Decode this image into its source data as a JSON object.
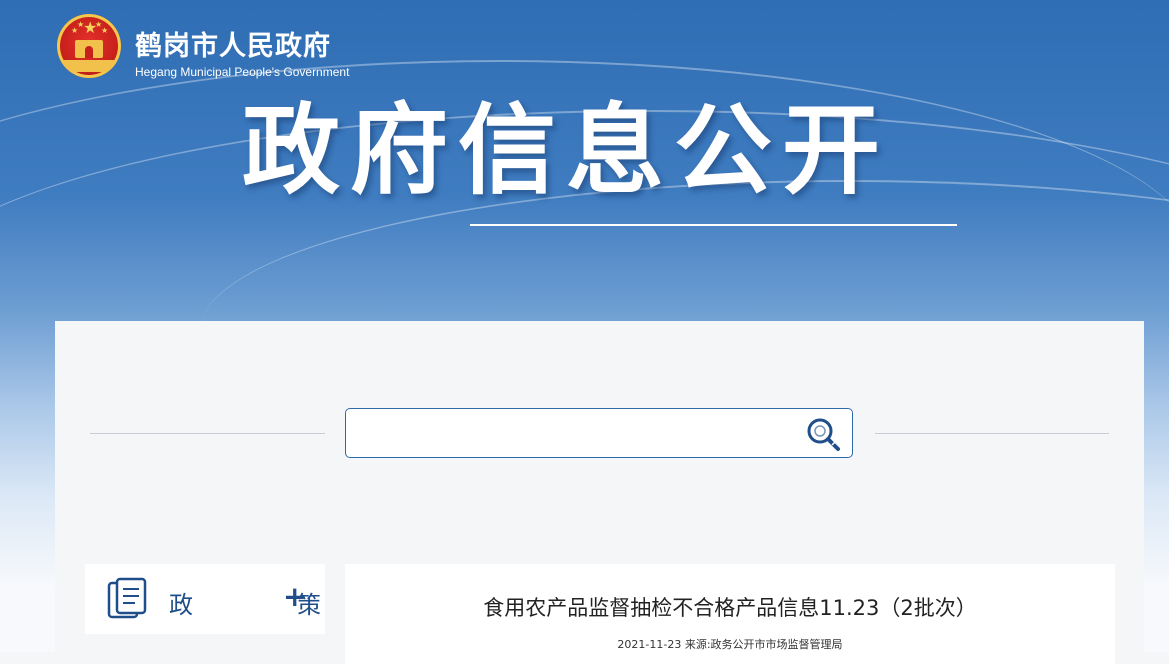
{
  "header": {
    "site_title": "鹤岗市人民政府",
    "site_subtitle": "Hegang Municipal People's Government",
    "hero_title": "政府信息公开"
  },
  "search": {
    "placeholder": "",
    "value": ""
  },
  "sidebar": {
    "section_label": "政　策",
    "expand_icon": "plus-icon"
  },
  "article": {
    "title": "食用农产品监督抽检不合格产品信息11.23（2批次）",
    "meta": "2021-11-23 来源:政务公开市市场监督管理局"
  },
  "colors": {
    "brand_blue": "#2f6db4",
    "accent_dark_blue": "#1f4e8a",
    "emblem_red": "#c7201b",
    "emblem_gold": "#f2c14b"
  }
}
